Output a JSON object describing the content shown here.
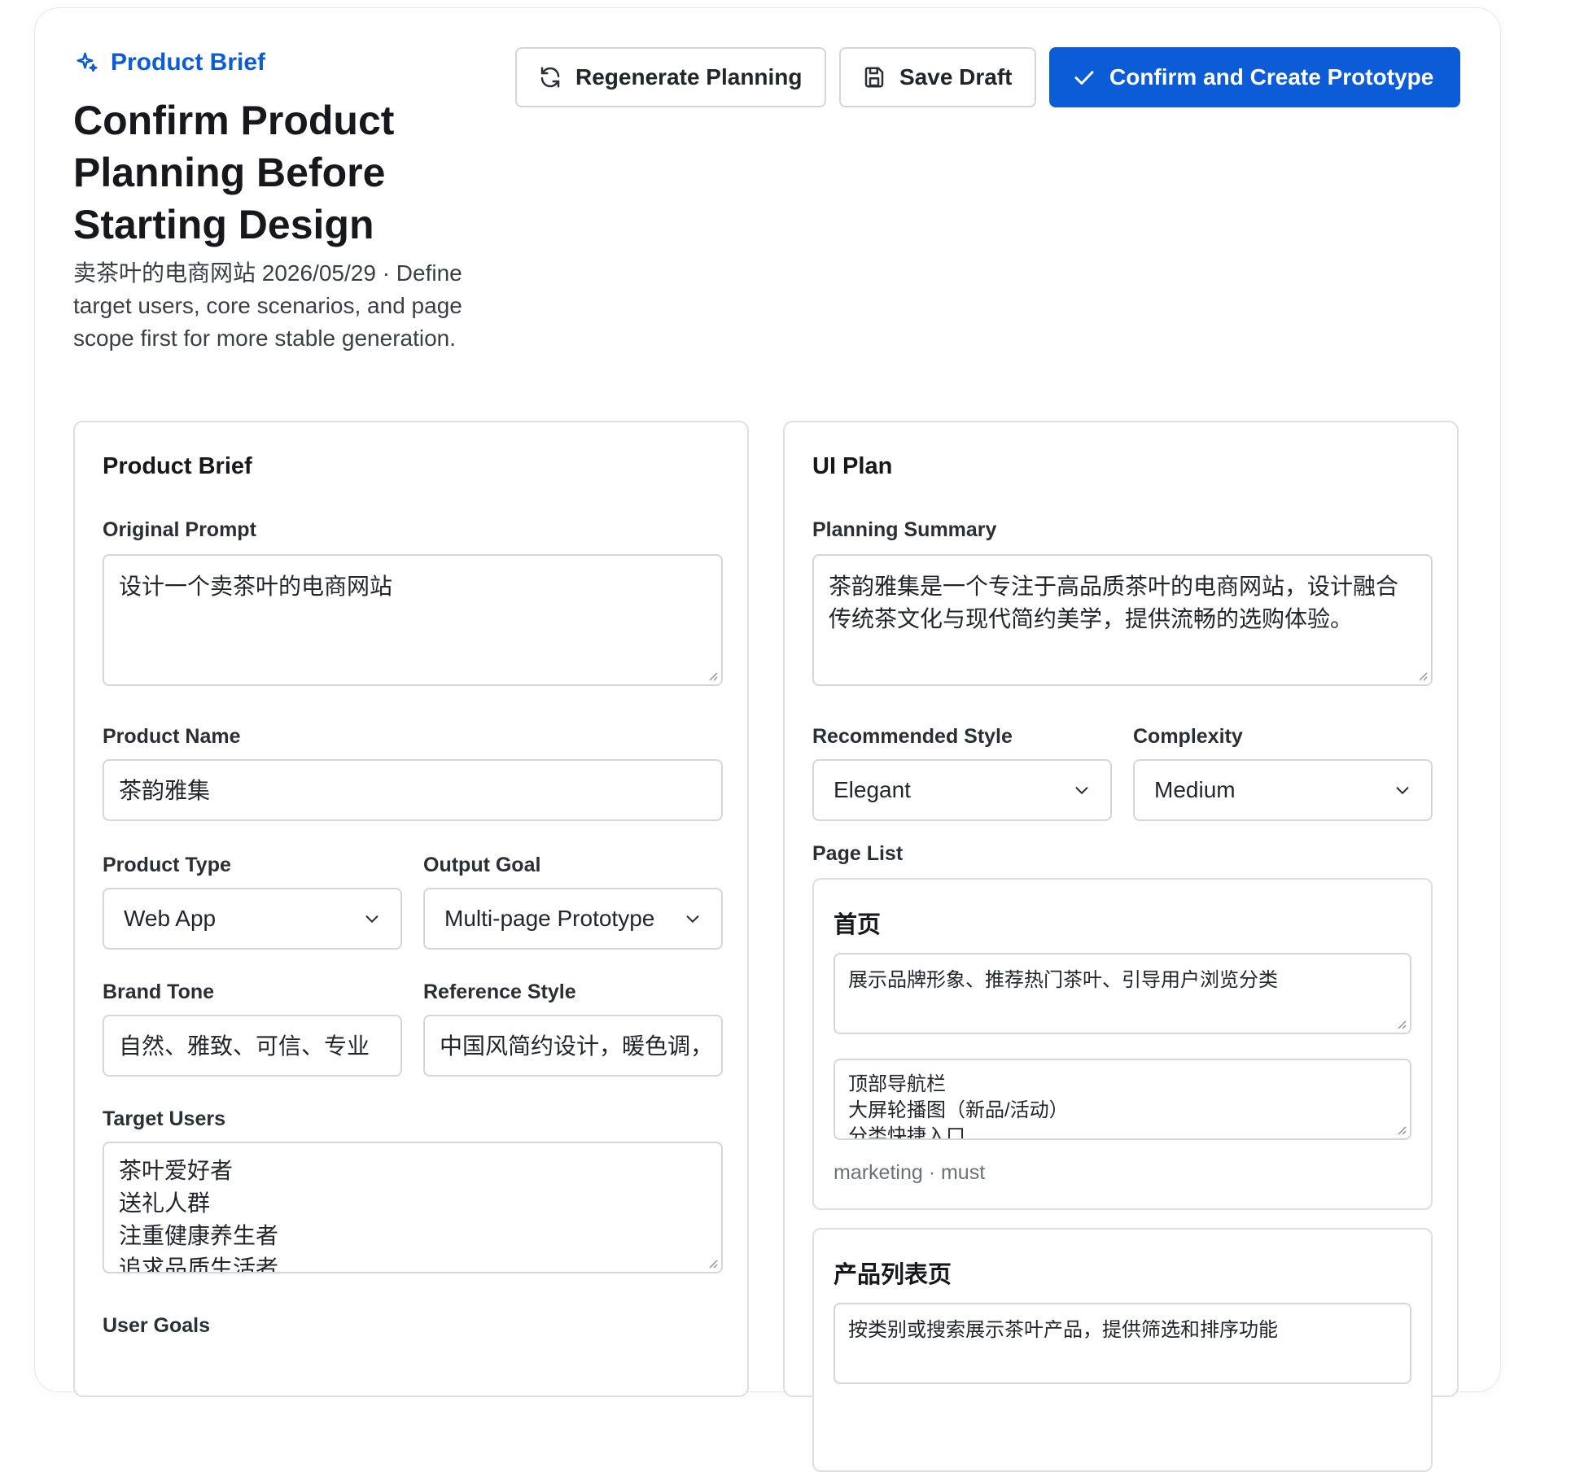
{
  "header": {
    "eyebrow": "Product Brief",
    "title": "Confirm Product Planning Before Starting Design",
    "subtitle": "卖茶叶的电商网站 2026/05/29 · Define target users, core scenarios, and page scope first for more stable generation."
  },
  "toolbar": {
    "regenerate_label": "Regenerate Planning",
    "save_label": "Save Draft",
    "confirm_label": "Confirm and Create Prototype"
  },
  "brief": {
    "title": "Product Brief",
    "original_prompt_label": "Original Prompt",
    "original_prompt": "设计一个卖茶叶的电商网站",
    "product_name_label": "Product Name",
    "product_name": "茶韵雅集",
    "product_type_label": "Product Type",
    "product_type": "Web App",
    "output_goal_label": "Output Goal",
    "output_goal": "Multi-page Prototype",
    "brand_tone_label": "Brand Tone",
    "brand_tone": "自然、雅致、可信、专业",
    "reference_style_label": "Reference Style",
    "reference_style": "中国风简约设计，暖色调，",
    "target_users_label": "Target Users",
    "target_users": [
      "茶叶爱好者",
      "送礼人群",
      "注重健康养生者",
      "追求品质生活者"
    ],
    "user_goals_label": "User Goals"
  },
  "plan": {
    "title": "UI Plan",
    "summary_label": "Planning Summary",
    "summary": "茶韵雅集是一个专注于高品质茶叶的电商网站，设计融合传统茶文化与现代简约美学，提供流畅的选购体验。",
    "style_label": "Recommended Style",
    "style": "Elegant",
    "complexity_label": "Complexity",
    "complexity": "Medium",
    "page_list_label": "Page List",
    "pages": [
      {
        "name": "首页",
        "description": "展示品牌形象、推荐热门茶叶、引导用户浏览分类",
        "modules": [
          "顶部导航栏",
          "大屏轮播图（新品/活动）",
          "分类快捷入口"
        ],
        "meta": "marketing · must"
      },
      {
        "name": "产品列表页",
        "description": "按类别或搜索展示茶叶产品，提供筛选和排序功能"
      }
    ]
  },
  "icons": {
    "sparkle": "sparkle-icon",
    "refresh": "refresh-icon",
    "save": "floppy-disk-icon",
    "check": "check-icon",
    "chevron": "chevron-down-icon"
  },
  "colors": {
    "accent": "#0b5cd6",
    "border": "#d3d6db",
    "muted_text": "#6b7079"
  }
}
